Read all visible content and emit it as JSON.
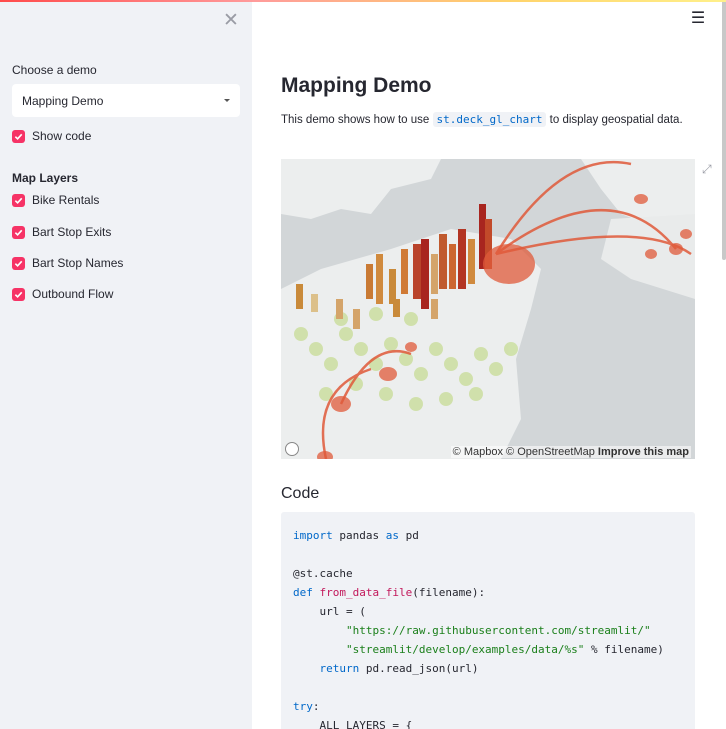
{
  "sidebar": {
    "close_symbol": "✕",
    "choose_label": "Choose a demo",
    "selected_demo": "Mapping Demo",
    "show_code_label": "Show code",
    "layers_title": "Map Layers",
    "layers": [
      {
        "label": "Bike Rentals",
        "checked": true
      },
      {
        "label": "Bart Stop Exits",
        "checked": true
      },
      {
        "label": "Bart Stop Names",
        "checked": true
      },
      {
        "label": "Outbound Flow",
        "checked": true
      }
    ]
  },
  "main": {
    "menu_symbol": "☰",
    "title": "Mapping Demo",
    "desc_before": "This demo shows how to use ",
    "desc_code": "st.deck_gl_chart",
    "desc_after": " to display geospatial data.",
    "map_attribution": {
      "mapbox": "© Mapbox",
      "osm": "© OpenStreetMap",
      "improve": "Improve this map"
    },
    "code_heading": "Code",
    "code_lines": [
      {
        "text": "import pandas as pd"
      },
      {
        "text": ""
      },
      {
        "text": "@st.cache"
      },
      {
        "text": "def from_data_file(filename):"
      },
      {
        "text": "    url = ("
      },
      {
        "text": "        \"https://raw.githubusercontent.com/streamlit/\""
      },
      {
        "text": "        \"streamlit/develop/examples/data/%s\" % filename)"
      },
      {
        "text": "    return pd.read_json(url)"
      },
      {
        "text": ""
      },
      {
        "text": "try:"
      },
      {
        "text": "    ALL_LAYERS = {"
      }
    ]
  },
  "colors": {
    "accent": "#f63366",
    "sidebar_bg": "#f0f2f6",
    "code_keyword": "#0068c9",
    "code_string": "#1a7f1a"
  },
  "icons": {
    "close": "close-icon",
    "menu": "hamburger-menu-icon",
    "check": "check-icon",
    "dropdown": "chevron-down-icon",
    "fullscreen": "fullscreen-icon"
  }
}
